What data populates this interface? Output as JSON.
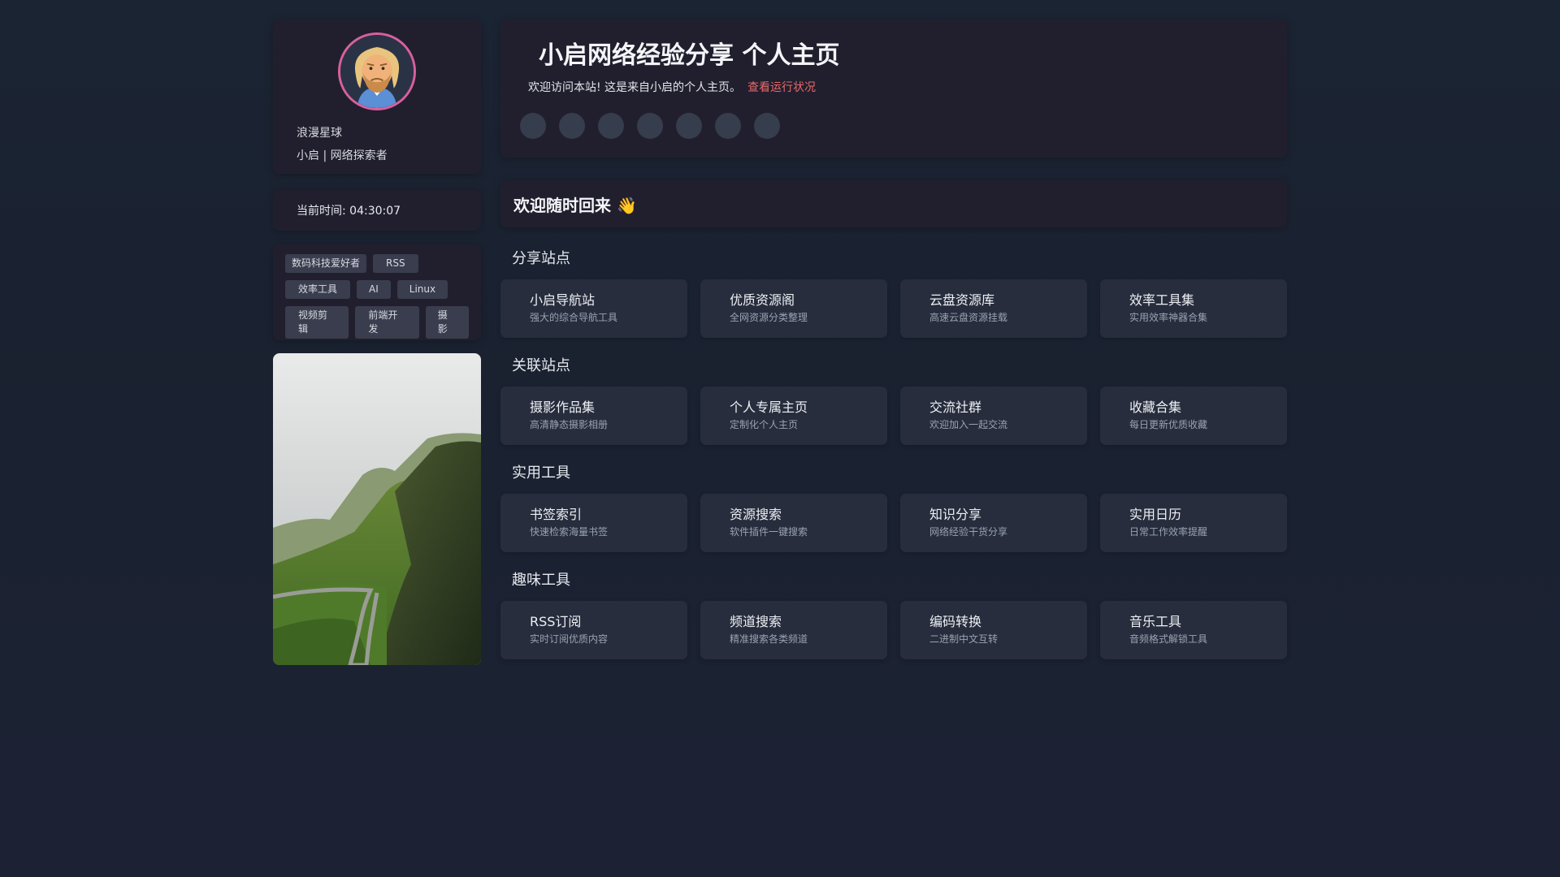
{
  "profile": {
    "name": "浪漫星球",
    "bio": "小启 | 网络探索者"
  },
  "clock": {
    "text": "当前时间: 04:30:07"
  },
  "tags": [
    [
      "数码科技爱好者",
      "RSS"
    ],
    [
      "效率工具",
      "AI",
      "Linux"
    ],
    [
      "视频剪辑",
      "前端开发",
      "摄影"
    ]
  ],
  "hero": {
    "title": "小启网络经验分享 个人主页",
    "subtitle": "欢迎访问本站! 这是来自小启的个人主页。",
    "status_link": "查看运行状况",
    "social_count": 7
  },
  "welcome": {
    "text": "欢迎随时回来 👋"
  },
  "sections": [
    {
      "title": "分享站点",
      "items": [
        {
          "name": "小启导航站",
          "desc": "强大的综合导航工具"
        },
        {
          "name": "优质资源阁",
          "desc": "全网资源分类整理"
        },
        {
          "name": "云盘资源库",
          "desc": "高速云盘资源挂载"
        },
        {
          "name": "效率工具集",
          "desc": "实用效率神器合集"
        }
      ]
    },
    {
      "title": "关联站点",
      "items": [
        {
          "name": "摄影作品集",
          "desc": "高清静态摄影相册"
        },
        {
          "name": "个人专属主页",
          "desc": "定制化个人主页"
        },
        {
          "name": "交流社群",
          "desc": "欢迎加入一起交流"
        },
        {
          "name": "收藏合集",
          "desc": "每日更新优质收藏"
        }
      ]
    },
    {
      "title": "实用工具",
      "items": [
        {
          "name": "书签索引",
          "desc": "快速检索海量书签"
        },
        {
          "name": "资源搜索",
          "desc": "软件插件一键搜索"
        },
        {
          "name": "知识分享",
          "desc": "网络经验干货分享"
        },
        {
          "name": "实用日历",
          "desc": "日常工作效率提醒"
        }
      ]
    },
    {
      "title": "趣味工具",
      "items": [
        {
          "name": "RSS订阅",
          "desc": "实时订阅优质内容"
        },
        {
          "name": "频道搜索",
          "desc": "精准搜索各类频道"
        },
        {
          "name": "编码转换",
          "desc": "二进制中文互转"
        },
        {
          "name": "音乐工具",
          "desc": "音频格式解锁工具"
        }
      ]
    }
  ],
  "colors": {
    "accent_link": "#e86a6a",
    "avatar_ring": "#d9609c",
    "card_bg": "#272d3d"
  }
}
